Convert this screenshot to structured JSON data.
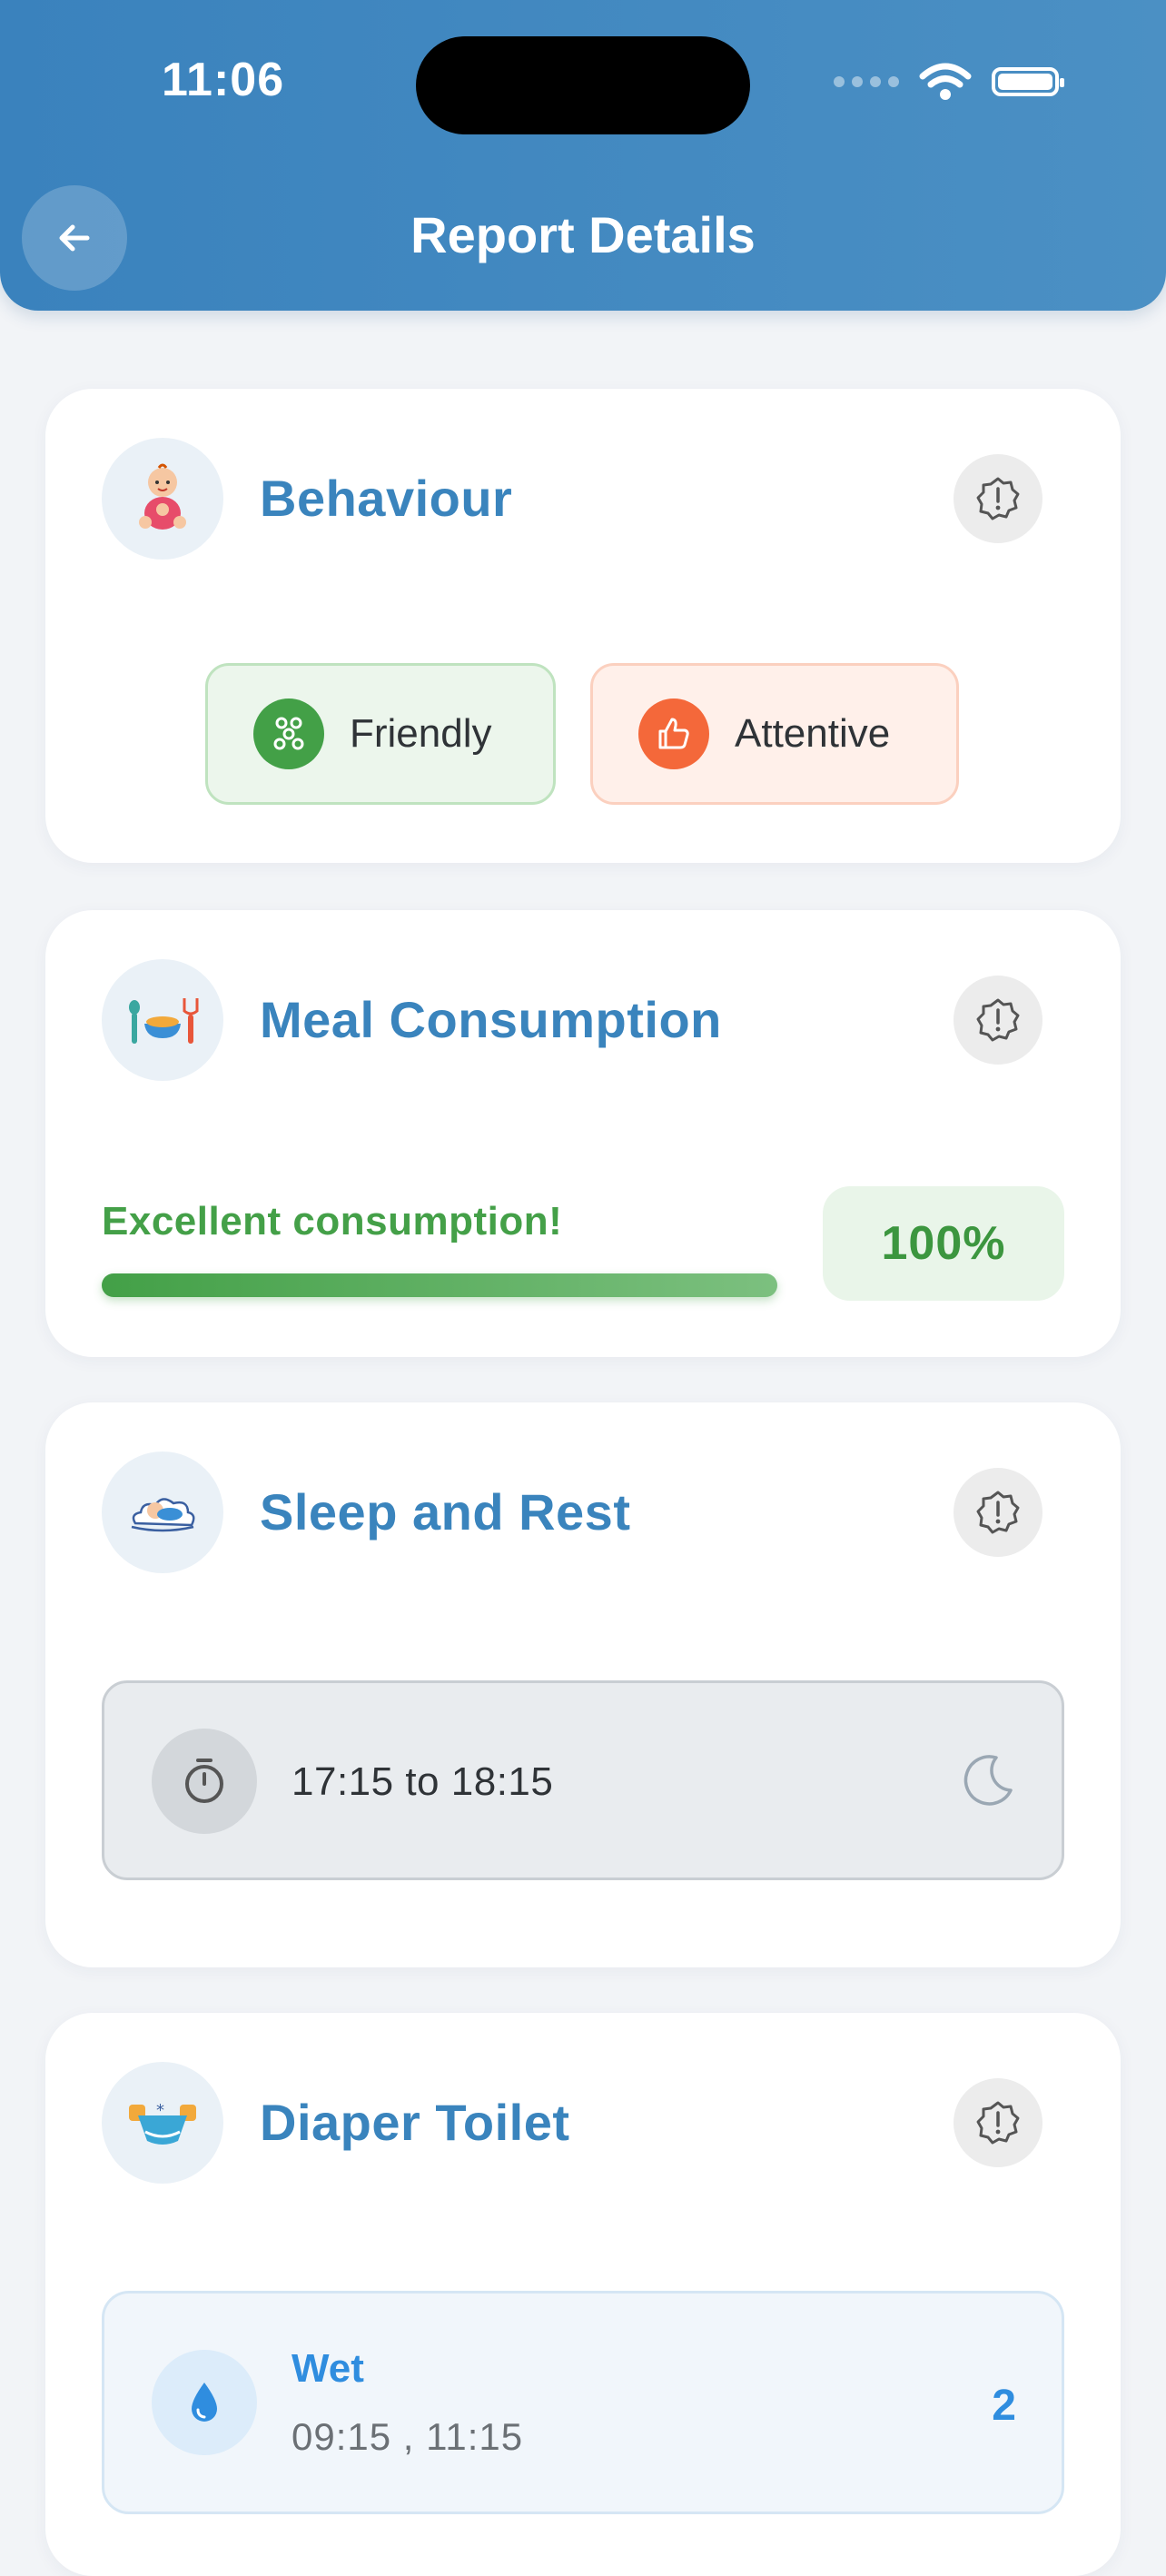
{
  "status_bar": {
    "time": "11:06"
  },
  "header": {
    "title": "Report Details"
  },
  "behaviour": {
    "title": "Behaviour",
    "chips": [
      {
        "label": "Friendly",
        "color": "#43a047"
      },
      {
        "label": "Attentive",
        "color": "#f4683a"
      }
    ]
  },
  "meal": {
    "title": "Meal Consumption",
    "message": "Excellent consumption!",
    "percent_label": "100%",
    "progress": 1.0
  },
  "sleep": {
    "title": "Sleep and Rest",
    "time_range": "17:15 to 18:15"
  },
  "diaper": {
    "title": "Diaper Toilet",
    "entries": [
      {
        "label": "Wet",
        "times": "09:15 , 11:15",
        "count": "2"
      }
    ]
  },
  "colors": {
    "header_start": "#3a82bd",
    "header_end": "#4b90c4",
    "title_blue": "#3a84bd",
    "success_green": "#43a047",
    "wet_blue": "#2f8ddf"
  }
}
